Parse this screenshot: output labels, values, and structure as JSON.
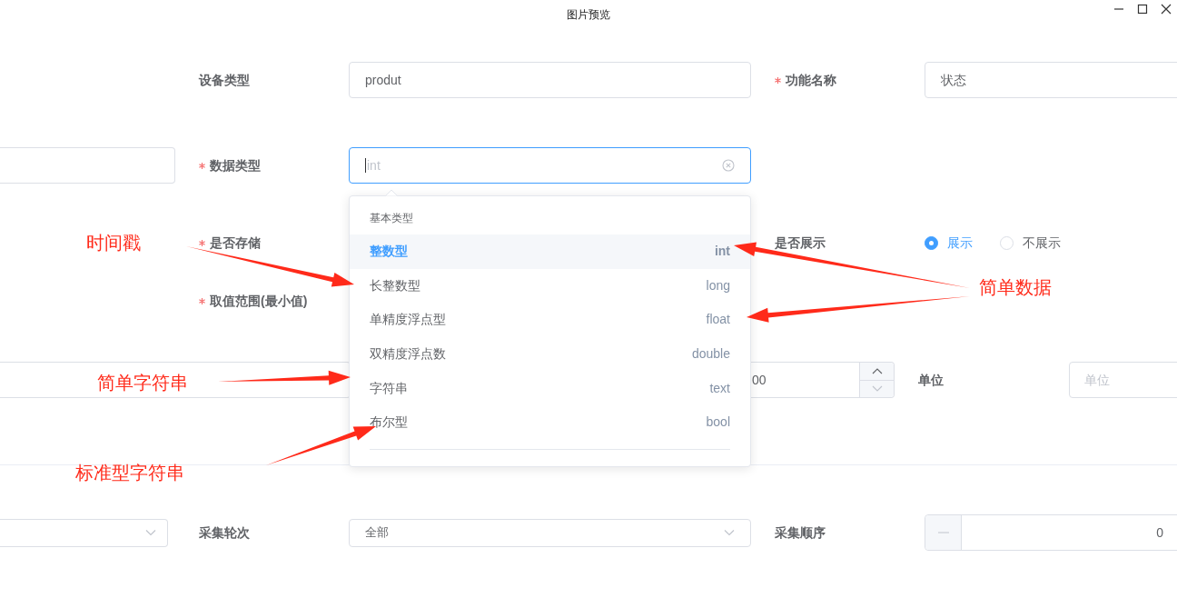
{
  "window": {
    "title": "图片预览"
  },
  "device_type": {
    "label": "设备类型",
    "value": "produt"
  },
  "function_name": {
    "label": "功能名称",
    "required": true,
    "value": "状态"
  },
  "data_type": {
    "label": "数据类型",
    "required": true,
    "placeholder": "int"
  },
  "store": {
    "label": "是否存储",
    "required": true
  },
  "display": {
    "label": "是否展示",
    "options": [
      {
        "label": "展示",
        "selected": true
      },
      {
        "label": "不展示",
        "selected": false
      }
    ]
  },
  "range_min": {
    "label": "取值范围(最小值)",
    "required": true
  },
  "range_max": {
    "value": "00"
  },
  "unit": {
    "label": "单位",
    "placeholder": "单位"
  },
  "collect_round": {
    "label": "采集轮次",
    "value": "全部"
  },
  "collect_order": {
    "label": "采集顺序",
    "value": "0"
  },
  "dropdown": {
    "group": "基本类型",
    "options": [
      {
        "label": "整数型",
        "code": "int",
        "selected": true
      },
      {
        "label": "长整数型",
        "code": "long",
        "selected": false
      },
      {
        "label": "单精度浮点型",
        "code": "float",
        "selected": false
      },
      {
        "label": "双精度浮点数",
        "code": "double",
        "selected": false
      },
      {
        "label": "字符串",
        "code": "text",
        "selected": false
      },
      {
        "label": "布尔型",
        "code": "bool",
        "selected": false
      }
    ]
  },
  "annotations": [
    {
      "text": "时间戳"
    },
    {
      "text": "简单数据"
    },
    {
      "text": "简单字符串"
    },
    {
      "text": "标准型字符串"
    }
  ]
}
